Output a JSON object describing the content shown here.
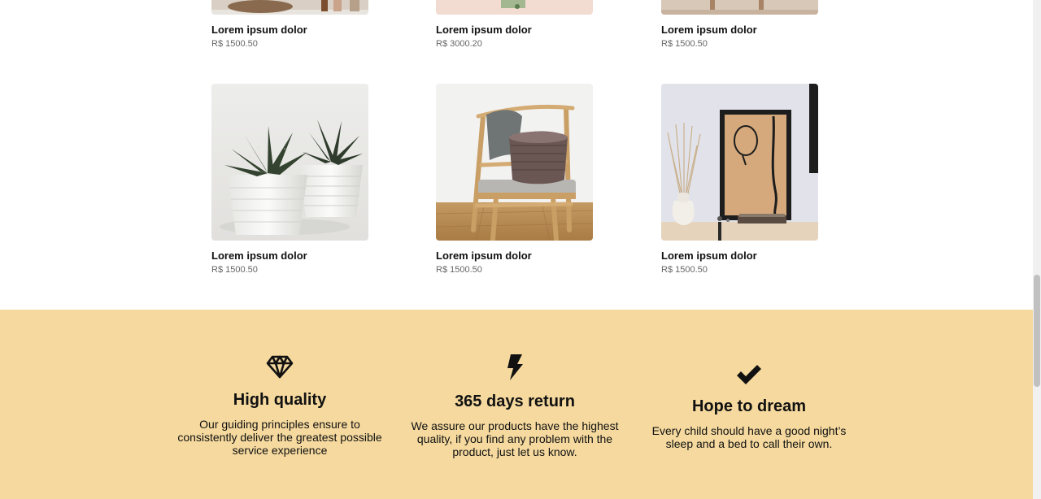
{
  "products_top": [
    {
      "name": "Lorem ipsum dolor",
      "price": "R$ 1500.50"
    },
    {
      "name": "Lorem ipsum dolor",
      "price": "R$ 3000.20"
    },
    {
      "name": "Lorem ipsum dolor",
      "price": "R$ 1500.50"
    }
  ],
  "products_bottom": [
    {
      "name": "Lorem ipsum dolor",
      "price": "R$ 1500.50",
      "image": "succulent-plant-pots"
    },
    {
      "name": "Lorem ipsum dolor",
      "price": "R$ 1500.50",
      "image": "wooden-chair-with-basket"
    },
    {
      "name": "Lorem ipsum dolor",
      "price": "R$ 1500.50",
      "image": "framed-art-with-vase"
    }
  ],
  "features": [
    {
      "icon": "diamond-icon",
      "title": "High quality",
      "text": "Our guiding principles ensure to consistently deliver the greatest possible service experience"
    },
    {
      "icon": "lightning-bolt-icon",
      "title": "365 days return",
      "text": "We assure our products have the highest quality, if you find any problem with the product, just let us know."
    },
    {
      "icon": "checkmark-icon",
      "title": "Hope to dream",
      "text": "Every child should have a good night’s sleep and a bed to call their own."
    }
  ],
  "colors": {
    "features_background": "#f5d99e",
    "price_text": "#666666"
  }
}
